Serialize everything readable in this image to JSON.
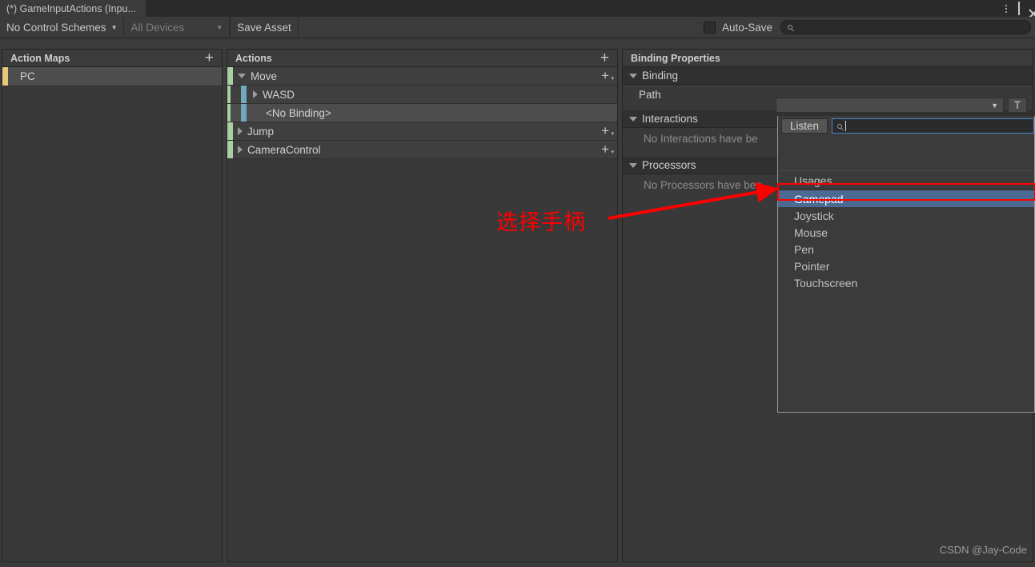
{
  "window": {
    "tab_title": "(*) GameInputActions (Inpu...",
    "menu_icon": "kebab-menu-icon",
    "maximize_icon": "maximize-icon",
    "close_icon": "close-icon"
  },
  "toolbar": {
    "control_schemes": "No Control Schemes",
    "devices": "All Devices",
    "save_asset": "Save Asset",
    "auto_save_label": "Auto-Save",
    "auto_save_checked": false,
    "search_placeholder": "",
    "search_value": "",
    "search_icon": "search-icon"
  },
  "action_maps": {
    "header": "Action Maps",
    "add_icon": "plus-icon",
    "accent_color": "#e6c87a",
    "items": [
      {
        "label": "PC",
        "selected": true
      }
    ]
  },
  "actions": {
    "header": "Actions",
    "add_icon": "plus-icon",
    "action_accent_color": "#a9d0a2",
    "binding_accent_color": "#72a8bb",
    "rows": [
      {
        "label": "Move",
        "type": "action",
        "expanded": true,
        "indent": 0,
        "selected": false,
        "has_add": true
      },
      {
        "label": "WASD",
        "type": "binding",
        "expanded": false,
        "indent": 1,
        "selected": false,
        "has_add": false
      },
      {
        "label": "<No Binding>",
        "type": "binding",
        "expanded": null,
        "indent": 2,
        "selected": true,
        "has_add": false
      },
      {
        "label": "Jump",
        "type": "action",
        "expanded": false,
        "indent": 0,
        "selected": false,
        "has_add": true
      },
      {
        "label": "CameraControl",
        "type": "action",
        "expanded": false,
        "indent": 0,
        "selected": false,
        "has_add": true
      }
    ]
  },
  "binding_properties": {
    "header": "Binding Properties",
    "binding_section": "Binding",
    "path_label": "Path",
    "path_value": "",
    "path_caret_icon": "chevron-down-icon",
    "t_button": "T",
    "interactions_section": "Interactions",
    "interactions_empty": "No Interactions have be",
    "processors_section": "Processors",
    "processors_empty": "No Processors have bee"
  },
  "path_popup": {
    "listen_button": "Listen",
    "search_value": "",
    "search_icon": "search-icon",
    "group_label": "Usages",
    "items": [
      {
        "label": "Gamepad",
        "selected": true,
        "highlight_color": "#4a6a92"
      },
      {
        "label": "Joystick",
        "selected": false
      },
      {
        "label": "Mouse",
        "selected": false
      },
      {
        "label": "Pen",
        "selected": false
      },
      {
        "label": "Pointer",
        "selected": false
      },
      {
        "label": "Touchscreen",
        "selected": false
      }
    ]
  },
  "annotation": {
    "text": "选择手柄",
    "color": "#ff0000",
    "arrow": "red-arrow-pointing-to-gamepad"
  },
  "watermark": "CSDN @Jay-Code"
}
